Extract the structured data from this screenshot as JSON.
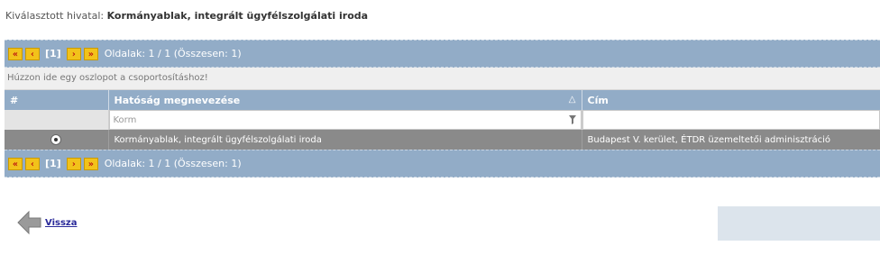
{
  "header": {
    "selected_label": "Kiválasztott hivatal:",
    "selected_value": "Kormányablak, integrált ügyfélszolgálati iroda"
  },
  "pager": {
    "first_icon": "double-chevron-left-icon",
    "prev_icon": "chevron-left-icon",
    "current_page": "[1]",
    "next_icon": "chevron-right-icon",
    "last_icon": "double-chevron-right-icon",
    "info": "Oldalak: 1 / 1 (Összesen: 1)"
  },
  "group_panel": {
    "hint": "Húzzon ide egy oszlopot a csoportosításhoz!"
  },
  "table": {
    "columns": [
      {
        "label": "#"
      },
      {
        "label": "Hatóság megnevezése",
        "sort_indicator": "△"
      },
      {
        "label": "Cím"
      }
    ],
    "filter": {
      "name_value": "Korm",
      "address_value": ""
    },
    "rows": [
      {
        "name": "Kormányablak, integrált ügyfélszolgálati iroda",
        "address": "Budapest V. kerület, ÉTDR üzemeltetői adminisztráció"
      }
    ]
  },
  "footer": {
    "back_label": "Vissza"
  },
  "colors": {
    "pager_bg": "#92acc7",
    "selected_row_bg": "#8a8a8a",
    "pager_button": "#f2c21a",
    "link": "#2a2a9a"
  }
}
